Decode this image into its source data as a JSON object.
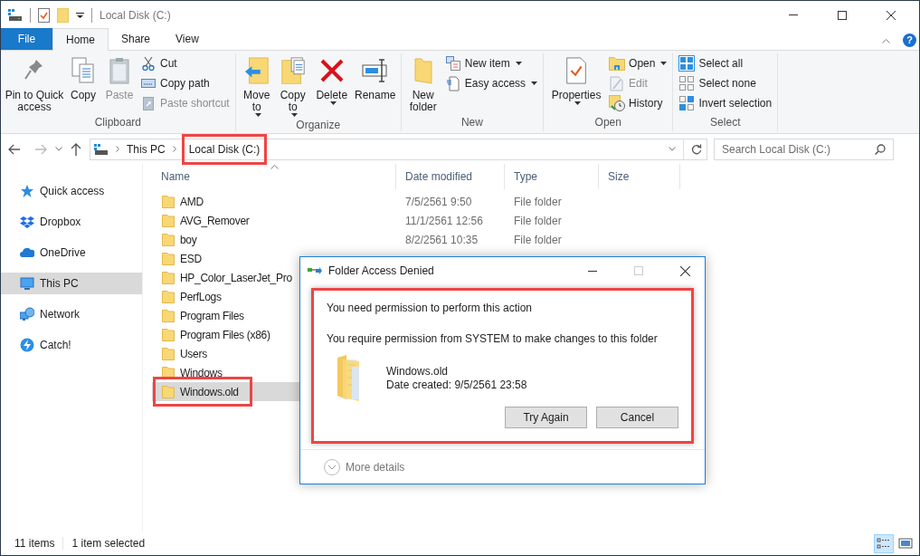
{
  "window": {
    "title": "Local Disk (C:)"
  },
  "ribbon_tabs": [
    {
      "label": "File",
      "kind": "file",
      "selected": false
    },
    {
      "label": "Home",
      "kind": "tab",
      "selected": true
    },
    {
      "label": "Share",
      "kind": "tab",
      "selected": false
    },
    {
      "label": "View",
      "kind": "tab",
      "selected": false
    }
  ],
  "help": "?",
  "ribbon_groups": [
    {
      "label": "Clipboard",
      "items": [
        {
          "kind": "large",
          "label": "Pin to Quick access",
          "disabled": false,
          "dropdown": false
        },
        {
          "kind": "large",
          "label": "Copy",
          "disabled": false,
          "dropdown": false
        },
        {
          "kind": "large",
          "label": "Paste",
          "disabled": true,
          "dropdown": false
        },
        {
          "kind": "small",
          "label": "Cut",
          "disabled": false,
          "dropdown": false
        },
        {
          "kind": "small",
          "label": "Copy path",
          "disabled": false,
          "dropdown": false
        },
        {
          "kind": "small",
          "label": "Paste shortcut",
          "disabled": true,
          "dropdown": false
        }
      ]
    },
    {
      "label": "Organize",
      "items": [
        {
          "kind": "large",
          "label": "Move to",
          "disabled": false,
          "dropdown": true
        },
        {
          "kind": "large",
          "label": "Copy to",
          "disabled": false,
          "dropdown": true
        },
        {
          "kind": "large",
          "label": "Delete",
          "disabled": false,
          "dropdown": true
        },
        {
          "kind": "large",
          "label": "Rename",
          "disabled": false,
          "dropdown": false
        }
      ]
    },
    {
      "label": "New",
      "items": [
        {
          "kind": "large",
          "label": "New folder",
          "disabled": false,
          "dropdown": false
        },
        {
          "kind": "small",
          "label": "New item",
          "disabled": false,
          "dropdown": true
        },
        {
          "kind": "small",
          "label": "Easy access",
          "disabled": false,
          "dropdown": true
        }
      ]
    },
    {
      "label": "Open",
      "items": [
        {
          "kind": "large",
          "label": "Properties",
          "disabled": false,
          "dropdown": true
        },
        {
          "kind": "small",
          "label": "Open",
          "disabled": false,
          "dropdown": true
        },
        {
          "kind": "small",
          "label": "Edit",
          "disabled": true,
          "dropdown": false
        },
        {
          "kind": "small",
          "label": "History",
          "disabled": false,
          "dropdown": false
        }
      ]
    },
    {
      "label": "Select",
      "items": [
        {
          "kind": "small",
          "label": "Select all",
          "disabled": false,
          "dropdown": false
        },
        {
          "kind": "small",
          "label": "Select none",
          "disabled": false,
          "dropdown": false
        },
        {
          "kind": "small",
          "label": "Invert selection",
          "disabled": false,
          "dropdown": false
        }
      ]
    }
  ],
  "address": {
    "crumbs": [
      {
        "label": "This PC",
        "highlighted": false
      },
      {
        "label": "Local Disk (C:)",
        "highlighted": true
      }
    ],
    "search_placeholder": "Search Local Disk (C:)"
  },
  "sidebar": {
    "items": [
      {
        "label": "Quick access",
        "selected": false
      },
      {
        "label": "Dropbox",
        "selected": false
      },
      {
        "label": "OneDrive",
        "selected": false
      },
      {
        "label": "This PC",
        "selected": true
      },
      {
        "label": "Network",
        "selected": false
      },
      {
        "label": "Catch!",
        "selected": false
      }
    ]
  },
  "table": {
    "columns": [
      "Name",
      "Date modified",
      "Type",
      "Size"
    ],
    "rows": [
      {
        "name": "AMD",
        "date": "7/5/2561 9:50",
        "type": "File folder",
        "selected": false,
        "highlighted": false
      },
      {
        "name": "AVG_Remover",
        "date": "11/1/2561 12:56",
        "type": "File folder",
        "selected": false,
        "highlighted": false
      },
      {
        "name": "boy",
        "date": "8/2/2561 10:35",
        "type": "File folder",
        "selected": false,
        "highlighted": false
      },
      {
        "name": "ESD",
        "selected": false,
        "highlighted": false
      },
      {
        "name": "HP_Color_LaserJet_Pro",
        "selected": false,
        "highlighted": false
      },
      {
        "name": "PerfLogs",
        "selected": false,
        "highlighted": false
      },
      {
        "name": "Program Files",
        "selected": false,
        "highlighted": false
      },
      {
        "name": "Program Files (x86)",
        "selected": false,
        "highlighted": false
      },
      {
        "name": "Users",
        "selected": false,
        "highlighted": false
      },
      {
        "name": "Windows",
        "selected": false,
        "highlighted": false
      },
      {
        "name": "Windows.old",
        "selected": true,
        "highlighted": true
      }
    ]
  },
  "status_bar": {
    "items": [
      "11 items",
      "1 item selected"
    ],
    "views": [
      {
        "kind": "details",
        "selected": true
      },
      {
        "kind": "thumbnails",
        "selected": false
      }
    ]
  },
  "dialog": {
    "title": "Folder Access Denied",
    "maximize_disabled": true,
    "highlighted": true,
    "heading": "You need permission to perform this action",
    "message": "You require permission from SYSTEM to make changes to this folder",
    "file_name": "Windows.old",
    "file_date": "Date created: 9/5/2561 23:58",
    "buttons": [
      "Try Again",
      "Cancel"
    ],
    "more_details": "More details"
  }
}
